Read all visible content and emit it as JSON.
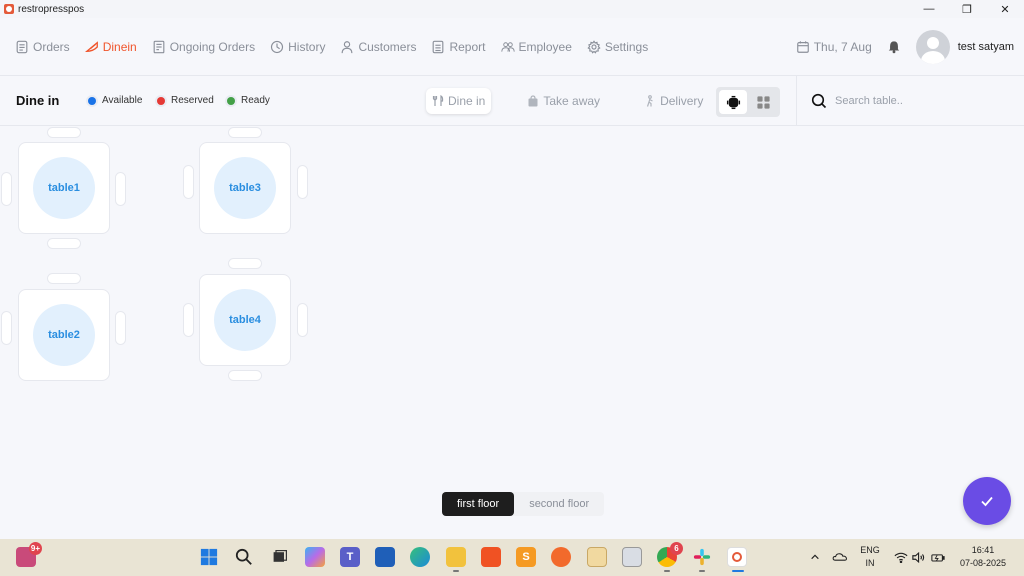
{
  "window": {
    "title": "restropresspos",
    "minimize_symbol": "—",
    "maximize_symbol": "❐",
    "close_symbol": "✕"
  },
  "nav": {
    "items": [
      {
        "label": "Orders",
        "icon": "orders-icon"
      },
      {
        "label": "Dinein",
        "icon": "dinein-icon",
        "active": true
      },
      {
        "label": "Ongoing Orders",
        "icon": "ongoing-orders-icon"
      },
      {
        "label": "History",
        "icon": "history-icon"
      },
      {
        "label": "Customers",
        "icon": "customers-icon"
      },
      {
        "label": "Report",
        "icon": "report-icon"
      },
      {
        "label": "Employee",
        "icon": "employee-icon"
      },
      {
        "label": "Settings",
        "icon": "settings-icon"
      }
    ],
    "date": "Thu, 7 Aug",
    "user_name": "test satyam"
  },
  "subbar": {
    "title": "Dine in",
    "legend": [
      {
        "label": "Available",
        "color": "#1a73e8"
      },
      {
        "label": "Reserved",
        "color": "#e53935"
      },
      {
        "label": "Ready",
        "color": "#43a047"
      }
    ],
    "order_tabs": [
      {
        "label": "Dine in",
        "active": true
      },
      {
        "label": "Take away"
      },
      {
        "label": "Delivery"
      }
    ],
    "search_placeholder": "Search table.."
  },
  "tables": [
    {
      "name": "table1"
    },
    {
      "name": "table3"
    },
    {
      "name": "table2"
    },
    {
      "name": "table4"
    }
  ],
  "floors": [
    {
      "label": "first floor",
      "active": true
    },
    {
      "label": "second floor"
    }
  ],
  "colors": {
    "accent": "#f0552c",
    "fab": "#6a4ce5",
    "table_circle": "#e2f0fd",
    "table_text": "#2a8ee0"
  },
  "taskbar": {
    "notification_badge": "9+",
    "chrome_badge": "6",
    "language": "ENG",
    "region": "IN",
    "time": "16:41",
    "date": "07-08-2025"
  }
}
